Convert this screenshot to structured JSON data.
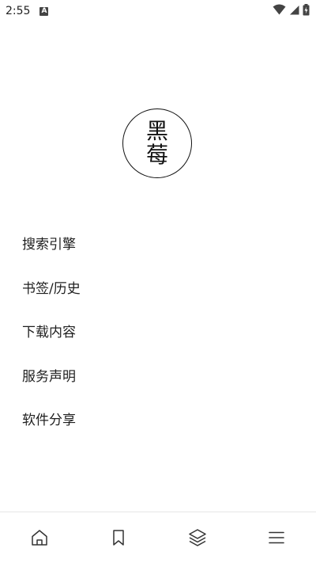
{
  "status_bar": {
    "time": "2:55",
    "notification_icon_letter": "A",
    "icons": [
      "notification-icon",
      "wifi-icon",
      "signal-icon",
      "battery-icon"
    ]
  },
  "logo": {
    "line1": "黑",
    "line2": "莓"
  },
  "menu": {
    "items": [
      {
        "label": "搜索引擎"
      },
      {
        "label": "书签/历史"
      },
      {
        "label": "下载内容"
      },
      {
        "label": "服务声明"
      },
      {
        "label": "软件分享"
      }
    ]
  },
  "bottom_nav": {
    "items": [
      {
        "icon": "home-icon"
      },
      {
        "icon": "bookmark-icon"
      },
      {
        "icon": "layers-icon"
      },
      {
        "icon": "menu-icon"
      }
    ]
  },
  "colors": {
    "background": "#ffffff",
    "text": "#1f1f1f",
    "icon": "#333333",
    "divider": "#e6e6e6"
  }
}
